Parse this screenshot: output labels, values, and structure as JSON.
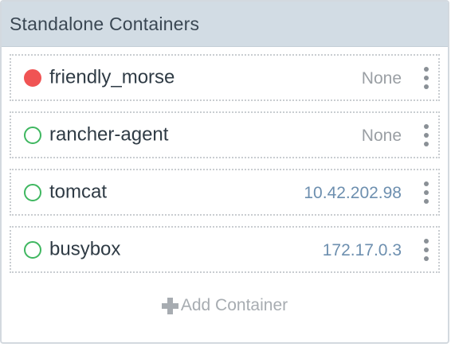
{
  "panel": {
    "title": "Standalone Containers",
    "add_label": "Add Container"
  },
  "colors": {
    "header_bg": "#d2dce4",
    "stopped": "#f05454",
    "running": "#3fb760",
    "ip_text": "#6d8faf",
    "muted_text": "#9a9fa4"
  },
  "containers": [
    {
      "name": "friendly_morse",
      "ip": "None",
      "state": "stopped",
      "status_icon": "filled-circle-icon",
      "menu_icon": "kebab-menu-icon"
    },
    {
      "name": "rancher-agent",
      "ip": "None",
      "state": "running",
      "status_icon": "hollow-circle-icon",
      "menu_icon": "kebab-menu-icon"
    },
    {
      "name": "tomcat",
      "ip": "10.42.202.98",
      "state": "running",
      "status_icon": "hollow-circle-icon",
      "menu_icon": "kebab-menu-icon"
    },
    {
      "name": "busybox",
      "ip": "172.17.0.3",
      "state": "running",
      "status_icon": "hollow-circle-icon",
      "menu_icon": "kebab-menu-icon"
    }
  ]
}
